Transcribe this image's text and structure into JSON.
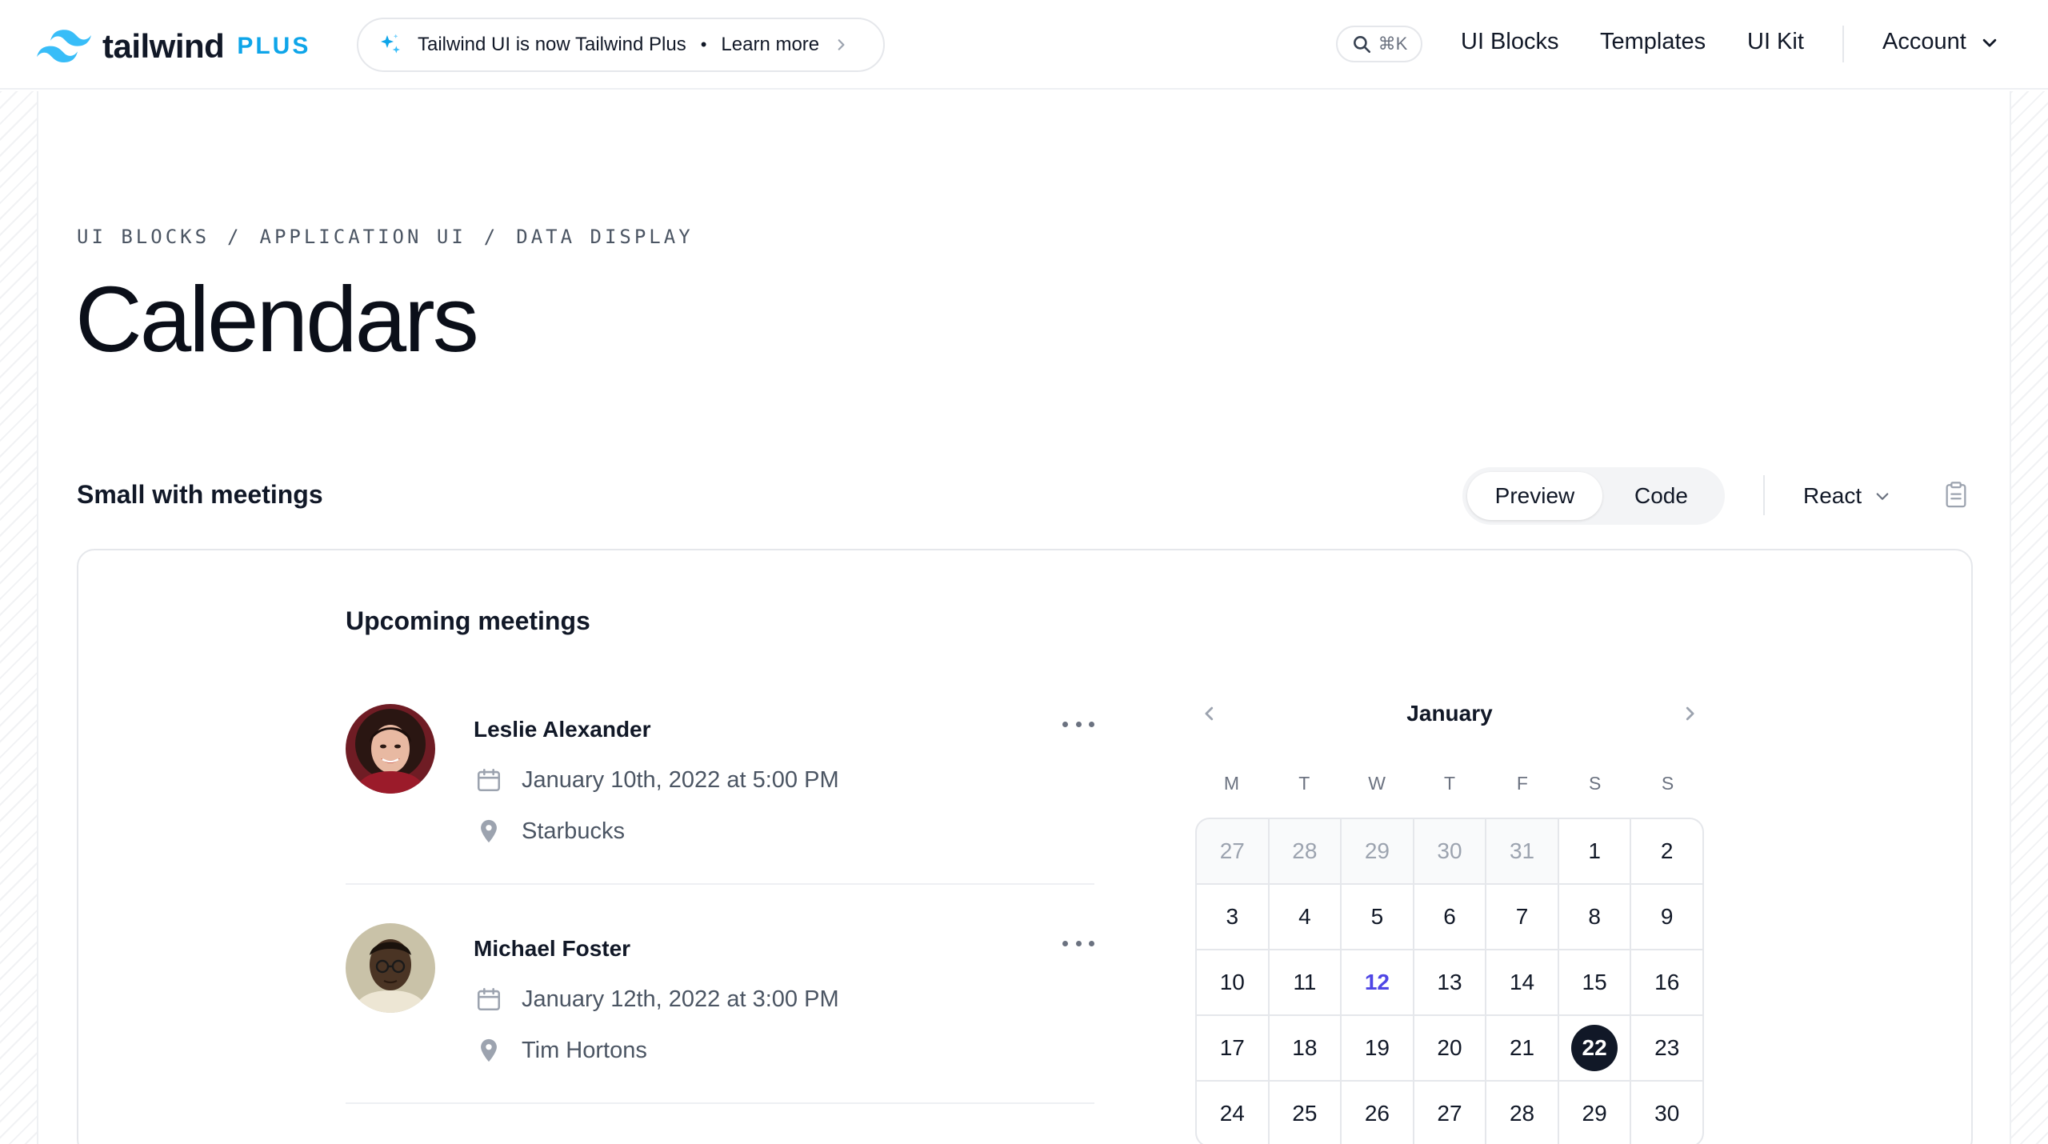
{
  "header": {
    "logo_word": "tailwind",
    "logo_plus": "PLUS",
    "announcement": {
      "text": "Tailwind UI is now Tailwind Plus",
      "separator": "•",
      "link": "Learn more"
    },
    "search_shortcut": "⌘K",
    "nav": [
      "UI Blocks",
      "Templates",
      "UI Kit"
    ],
    "account": "Account"
  },
  "breadcrumb": [
    "UI BLOCKS",
    "/",
    "APPLICATION UI",
    "/",
    "DATA DISPLAY"
  ],
  "page_title": "Calendars",
  "section": {
    "title": "Small with meetings",
    "toggle": {
      "preview": "Preview",
      "code": "Code"
    },
    "framework": "React"
  },
  "preview": {
    "heading": "Upcoming meetings",
    "meetings": [
      {
        "name": "Leslie Alexander",
        "datetime": "January 10th, 2022 at 5:00 PM",
        "location": "Starbucks"
      },
      {
        "name": "Michael Foster",
        "datetime": "January 12th, 2022 at 3:00 PM",
        "location": "Tim Hortons"
      }
    ],
    "calendar": {
      "month": "January",
      "weekdays": [
        "M",
        "T",
        "W",
        "T",
        "F",
        "S",
        "S"
      ],
      "days": [
        {
          "d": "27",
          "muted": true
        },
        {
          "d": "28",
          "muted": true
        },
        {
          "d": "29",
          "muted": true
        },
        {
          "d": "30",
          "muted": true
        },
        {
          "d": "31",
          "muted": true
        },
        {
          "d": "1"
        },
        {
          "d": "2"
        },
        {
          "d": "3"
        },
        {
          "d": "4"
        },
        {
          "d": "5"
        },
        {
          "d": "6"
        },
        {
          "d": "7"
        },
        {
          "d": "8"
        },
        {
          "d": "9"
        },
        {
          "d": "10"
        },
        {
          "d": "11"
        },
        {
          "d": "12",
          "today": true
        },
        {
          "d": "13"
        },
        {
          "d": "14"
        },
        {
          "d": "15"
        },
        {
          "d": "16"
        },
        {
          "d": "17"
        },
        {
          "d": "18"
        },
        {
          "d": "19"
        },
        {
          "d": "20"
        },
        {
          "d": "21"
        },
        {
          "d": "22",
          "selected": true
        },
        {
          "d": "23"
        },
        {
          "d": "24"
        },
        {
          "d": "25"
        },
        {
          "d": "26"
        },
        {
          "d": "27"
        },
        {
          "d": "28"
        },
        {
          "d": "29"
        },
        {
          "d": "30"
        }
      ]
    }
  },
  "colors": {
    "brand": "#0ea5e9",
    "today": "#4f46e5",
    "selected_bg": "#111827"
  }
}
